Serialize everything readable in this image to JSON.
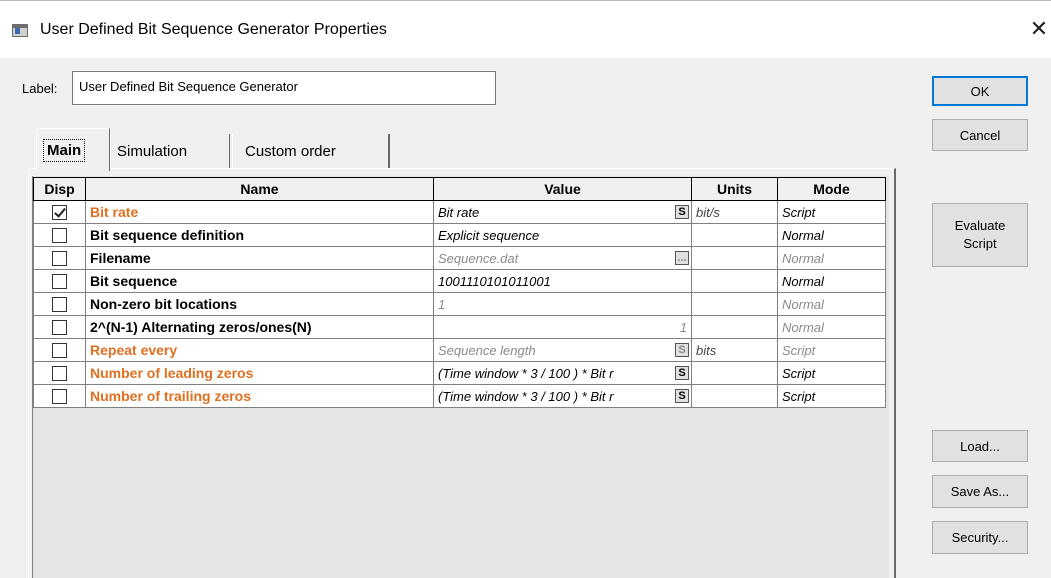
{
  "window": {
    "title": "User Defined Bit Sequence Generator Properties",
    "close_glyph": "✕",
    "icon": "component-icon"
  },
  "label": {
    "caption": "Label:",
    "value": "User Defined Bit Sequence Generator"
  },
  "buttons": {
    "ok": "OK",
    "cancel": "Cancel",
    "evaluate_script": "Evaluate Script",
    "load": "Load...",
    "save_as": "Save As...",
    "security": "Security..."
  },
  "tabs": [
    {
      "label": "Main",
      "active": true
    },
    {
      "label": "Simulation",
      "active": false
    },
    {
      "label": "Custom order",
      "active": false
    }
  ],
  "table": {
    "headers": [
      "Disp",
      "Name",
      "Value",
      "Units",
      "Mode"
    ],
    "rows": [
      {
        "disp": true,
        "name": "Bit rate",
        "value": "Bit rate",
        "units": "bit/s",
        "mode": "Script",
        "style": "script",
        "btn": "S"
      },
      {
        "disp": false,
        "name": "Bit sequence definition",
        "value": "Explicit sequence",
        "units": "",
        "mode": "Normal",
        "style": "normal"
      },
      {
        "disp": false,
        "name": "Filename",
        "value": "Sequence.dat",
        "units": "",
        "mode": "Normal",
        "style": "disabled",
        "btn": "..."
      },
      {
        "disp": false,
        "name": "Bit sequence",
        "value": "1001110101011001",
        "units": "",
        "mode": "Normal",
        "style": "normal"
      },
      {
        "disp": false,
        "name": "Non-zero bit locations",
        "value": "1",
        "units": "",
        "mode": "Normal",
        "style": "disabled"
      },
      {
        "disp": false,
        "name": "2^(N-1) Alternating zeros/ones(N)",
        "value": "1",
        "units": "",
        "mode": "Normal",
        "style": "disabled-right"
      },
      {
        "disp": false,
        "name": "Repeat every",
        "value": "Sequence length",
        "units": "bits",
        "mode": "Script",
        "style": "script-disabled",
        "btn": "S"
      },
      {
        "disp": false,
        "name": "Number of leading zeros",
        "value": "(Time window * 3 / 100 ) * Bit r",
        "units": "",
        "mode": "Script",
        "style": "script",
        "btn": "S"
      },
      {
        "disp": false,
        "name": "Number of trailing zeros",
        "value": "(Time window * 3 / 100 ) * Bit r",
        "units": "",
        "mode": "Script",
        "style": "script",
        "btn": "S"
      }
    ]
  }
}
